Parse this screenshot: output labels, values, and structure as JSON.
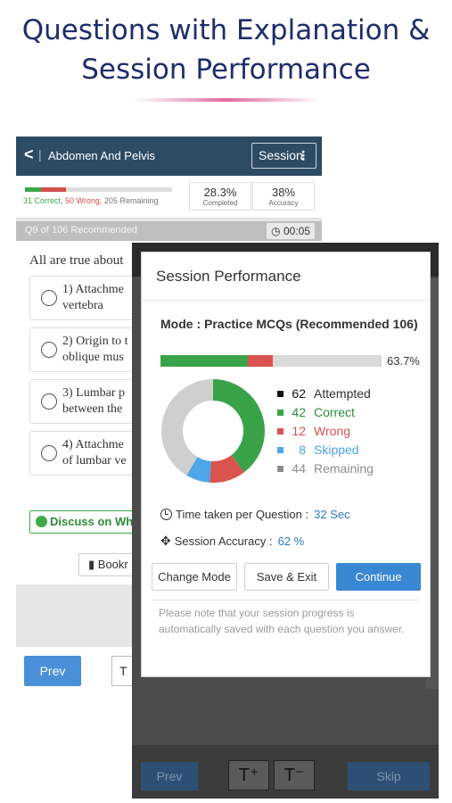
{
  "headline": {
    "line1": "Questions with Explanation &",
    "line2": "Session Performance"
  },
  "back_phone": {
    "topbar": {
      "back_glyph": "<",
      "separator": "|",
      "title": "Abdomen And Pelvis",
      "session_label": "Session",
      "menu_glyph": "⋮"
    },
    "stats": {
      "correct_text": "31 Correct,",
      "wrong_text": "50 Wrong,",
      "remaining_text": "205 Remaining",
      "completed": {
        "value": "28.3%",
        "label": "Completed"
      },
      "accuracy": {
        "value": "38%",
        "label": "Accuracy"
      },
      "progress": {
        "correct": 31,
        "wrong": 50,
        "remaining": 205
      }
    },
    "question": {
      "number_text": "Q9 of 106 Recommended",
      "timer": "00:05",
      "text": "All are true about"
    },
    "options": [
      {
        "label": "1) Attachme\nvertebra"
      },
      {
        "label": "2) Origin to t\noblique mus"
      },
      {
        "label": "3) Lumbar p\nbetween the"
      },
      {
        "label": "4) Attachme\nof lumbar ve"
      }
    ],
    "discuss_label": "Discuss on Wha",
    "bookmark_label": "Bookr",
    "prev_label": "Prev",
    "t_label": "T"
  },
  "front_phone": {
    "prev_label": "Prev",
    "t_plus": "T⁺",
    "t_minus": "T⁻",
    "skip_label": "Skip"
  },
  "modal": {
    "title": "Session Performance",
    "mode": "Mode : Practice MCQs (Recommended 106)",
    "progress_percent": "63.7%",
    "colors": {
      "attempted": "#111111",
      "correct": "#3aa34a",
      "wrong": "#d9534f",
      "skipped": "#4da6e8",
      "remaining": "#cfcfcf"
    },
    "stats": [
      {
        "key": "attempted",
        "count": "62",
        "label": "Attempted",
        "color": "#111111",
        "text_color": "#333333"
      },
      {
        "key": "correct",
        "count": "42",
        "label": "Correct",
        "color": "#3aa34a",
        "text_color": "#2e8b3a"
      },
      {
        "key": "wrong",
        "count": "12",
        "label": "Wrong",
        "color": "#d9534f",
        "text_color": "#d9534f"
      },
      {
        "key": "skipped",
        "count": "8",
        "label": "Skipped",
        "color": "#4da6e8",
        "text_color": "#4da6e8"
      },
      {
        "key": "remaining",
        "count": "44",
        "label": "Remaining",
        "color": "#8c8c8c",
        "text_color": "#8c8c8c"
      }
    ],
    "time_per_question": {
      "label": "Time taken per Question :",
      "value": "32 Sec"
    },
    "session_accuracy": {
      "label": "Session Accuracy :",
      "value": "62 %"
    },
    "buttons": {
      "change_mode": "Change Mode",
      "save_exit": "Save & Exit",
      "continue": "Continue"
    },
    "note": "Please note that your session progress is automatically saved with each question you answer."
  }
}
